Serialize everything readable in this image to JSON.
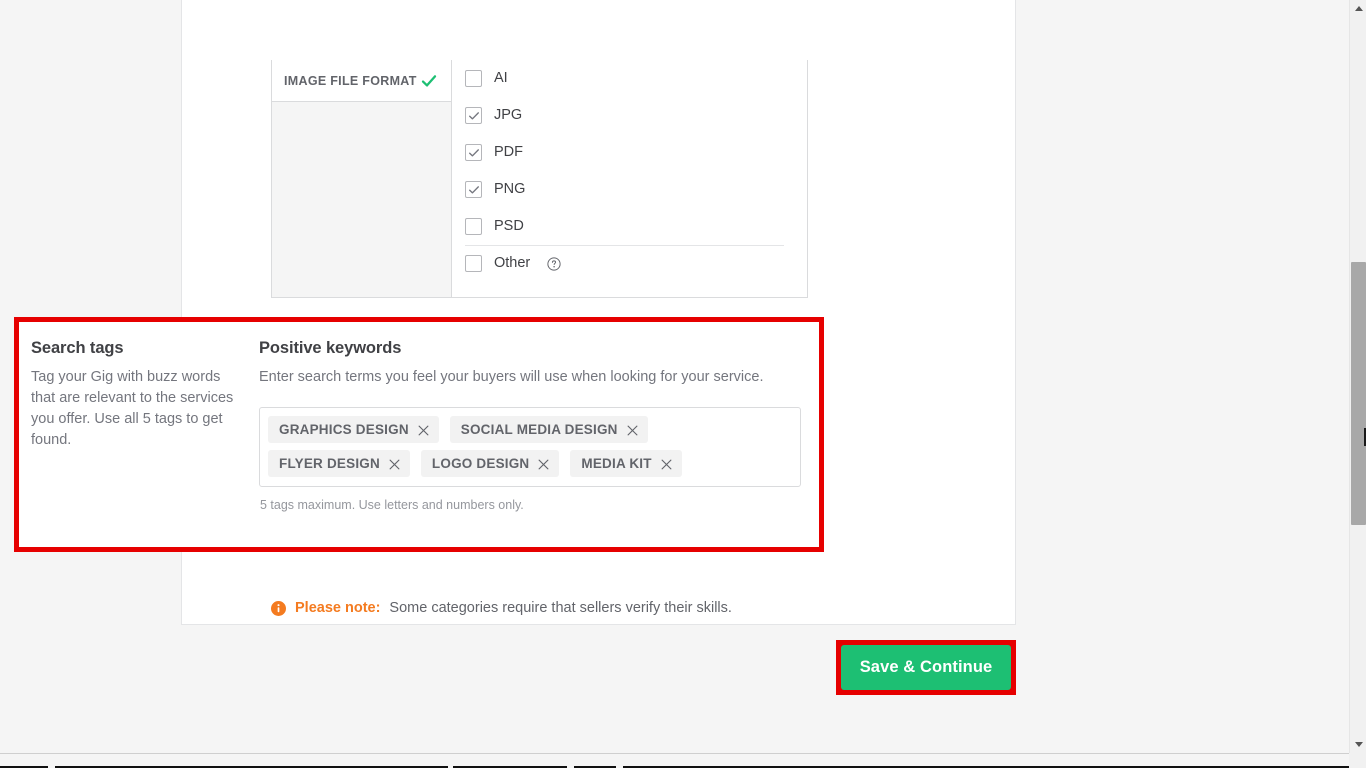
{
  "metadata": {
    "section_label": "IMAGE FILE FORMAT",
    "status_icon": "green-check-icon",
    "formats": [
      {
        "label": "AI",
        "checked": false,
        "divider": false,
        "help": false
      },
      {
        "label": "JPG",
        "checked": true,
        "divider": false,
        "help": false
      },
      {
        "label": "PDF",
        "checked": true,
        "divider": false,
        "help": false
      },
      {
        "label": "PNG",
        "checked": true,
        "divider": false,
        "help": false
      },
      {
        "label": "PSD",
        "checked": false,
        "divider": false,
        "help": false
      },
      {
        "label": "Other",
        "checked": false,
        "divider": true,
        "help": true
      }
    ]
  },
  "search_tags": {
    "title": "Search tags",
    "description": "Tag your Gig with buzz words that are relevant to the services you offer. Use all 5 tags to get found.",
    "positive_keywords": {
      "title": "Positive keywords",
      "description": "Enter search terms you feel your buyers will use when looking for your service.",
      "tags": [
        "GRAPHICS DESIGN",
        "SOCIAL MEDIA DESIGN",
        "FLYER DESIGN",
        "LOGO DESIGN",
        "MEDIA KIT"
      ],
      "hint": "5 tags maximum. Use letters and numbers only."
    }
  },
  "note": {
    "icon": "info-icon",
    "strong": "Please note:",
    "text": "Some categories require that sellers verify their skills."
  },
  "footer": {
    "save_label": "Save & Continue"
  },
  "colors": {
    "highlight_red": "#e60000",
    "brand_green": "#1dbf73",
    "note_orange": "#f47b20",
    "check_green": "#1dbf73"
  }
}
